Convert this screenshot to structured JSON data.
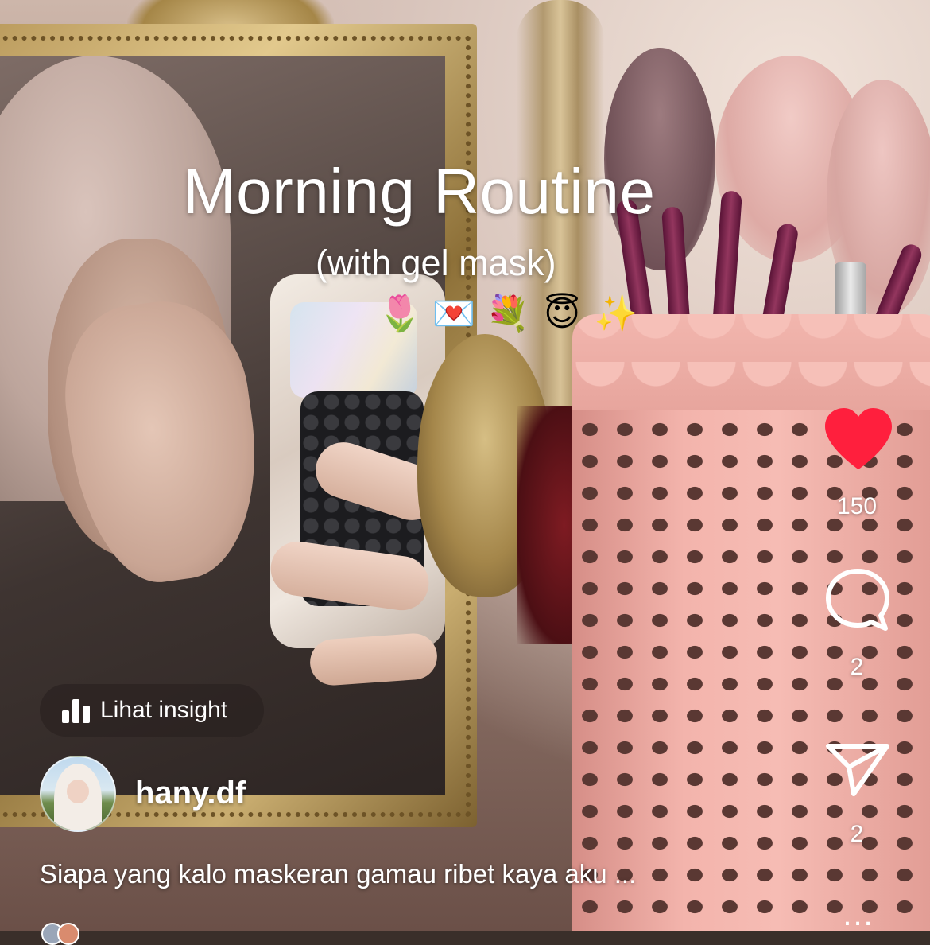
{
  "overlay": {
    "title": "Morning Routine",
    "subtitle": "(with gel mask)",
    "emojis": [
      "🌷",
      "💌",
      "💐",
      "😇",
      "✨"
    ]
  },
  "actions": {
    "like_count": "150",
    "comment_count": "2",
    "share_count": "2",
    "more_label": "...",
    "like_color": "#ff1f3d"
  },
  "insight": {
    "label": "Lihat insight"
  },
  "author": {
    "username": "hany.df"
  },
  "post": {
    "caption": "Siapa yang kalo maskeran gamau ribet kaya aku ..."
  },
  "icons": {
    "like": "heart-icon",
    "comment": "comment-bubble-icon",
    "share": "paper-plane-icon",
    "insight": "bar-chart-icon",
    "more": "more-dots-icon"
  }
}
